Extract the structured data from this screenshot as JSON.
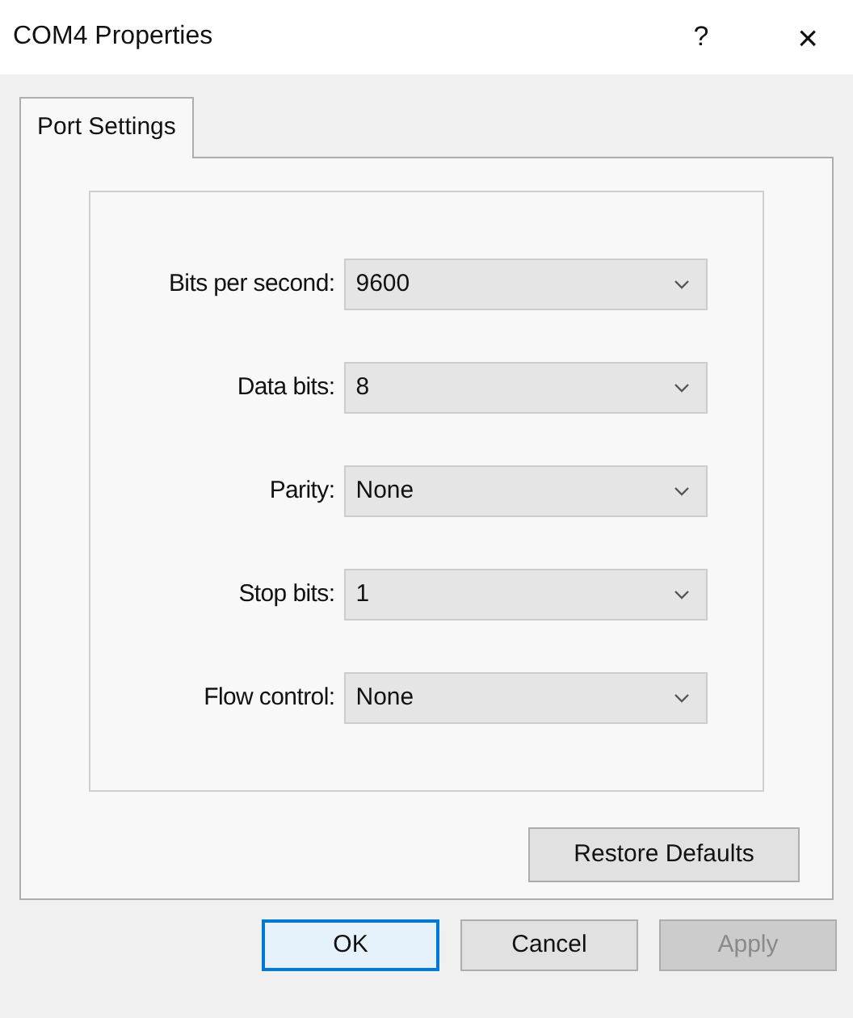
{
  "window": {
    "title": "COM4 Properties",
    "help": "?",
    "close": "×"
  },
  "tabs": [
    {
      "label": "Port Settings",
      "selected": true
    }
  ],
  "fields": [
    {
      "label": "Bits per second:",
      "value": "9600"
    },
    {
      "label": "Data bits:",
      "value": "8"
    },
    {
      "label": "Parity:",
      "value": "None"
    },
    {
      "label": "Stop bits:",
      "value": "1"
    },
    {
      "label": "Flow control:",
      "value": "None"
    }
  ],
  "restore_button": "Restore Defaults",
  "buttons": [
    {
      "label": "OK",
      "default": true,
      "disabled": false
    },
    {
      "label": "Cancel",
      "default": false,
      "disabled": false
    },
    {
      "label": "Apply",
      "default": false,
      "disabled": true
    }
  ]
}
